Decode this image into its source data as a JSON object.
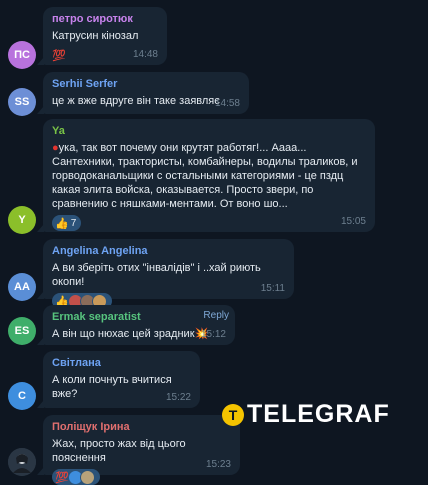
{
  "messages": [
    {
      "id": "m1",
      "avatar": {
        "initials": "ПС",
        "color": "#b872dd"
      },
      "name": "петро сиротюк",
      "name_color": "#c883ed",
      "text": "Катрусин кінозал",
      "reactions": [
        {
          "emoji": "💯",
          "count": "5"
        }
      ],
      "time": "14:48"
    },
    {
      "id": "m2",
      "avatar": {
        "initials": "SS",
        "color": "#6d8fd6"
      },
      "name": "Serhii Serfer",
      "name_color": "#6ea3f3",
      "text": "це ж вже вдруге він таке заявляє",
      "time": "14:58"
    },
    {
      "id": "m3",
      "avatar": {
        "initials": "Y",
        "color": "#8bbf2a"
      },
      "name": "Ya",
      "name_color": "#79c347",
      "text": "ука, так вот почему они крутят работяг!... Аааа... Сантехники, трактористы, комбайнеры, водилы траликов, и горводоканальщики с остальными категориями - це пздц какая элита войска, оказывается. Просто звери, по сравнению с няшками-ментами. От воно шо...",
      "reactions": [
        {
          "emoji": "👍",
          "count": "7"
        }
      ],
      "time": "15:05"
    },
    {
      "id": "m4",
      "avatar": {
        "initials": "AA",
        "color": "#5a8ed6"
      },
      "name": "Angelina Angelina",
      "name_color": "#6ea3f3",
      "text": "А ви зберіть отих  \"інвалідів\" і ..хай риють окопи!",
      "reactions": [
        {
          "emoji": "👍",
          "count": ""
        }
      ],
      "time": "15:11"
    },
    {
      "id": "m5",
      "avatar": {
        "initials": "ES",
        "color": "#3fae6a"
      },
      "name": "Ermak separatist",
      "name_color": "#57c47e",
      "text": "А він що нюхає цей зрадник💥",
      "reply": "Reply",
      "time": "15:12"
    },
    {
      "id": "m6",
      "avatar": {
        "initials": "C",
        "color": "#3e8ede"
      },
      "name": "Світлана",
      "name_color": "#6ea3f3",
      "text": "А коли почнуть вчитися вже?",
      "time": "15:22"
    },
    {
      "id": "m7",
      "avatar": {
        "initials": "",
        "color": "#2a3644"
      },
      "name": "Поліщук Ірина",
      "name_color": "#e06f6f",
      "text": "Жах, просто жах від цього пояснення",
      "reactions": [
        {
          "emoji": "💯",
          "count": ""
        }
      ],
      "time": "15:23"
    }
  ],
  "watermark": {
    "icon": "T",
    "text": "TELEGRAF"
  },
  "colors": {
    "background": "#0e1621",
    "bubble": "#182533",
    "reaction": "#2b5278"
  }
}
